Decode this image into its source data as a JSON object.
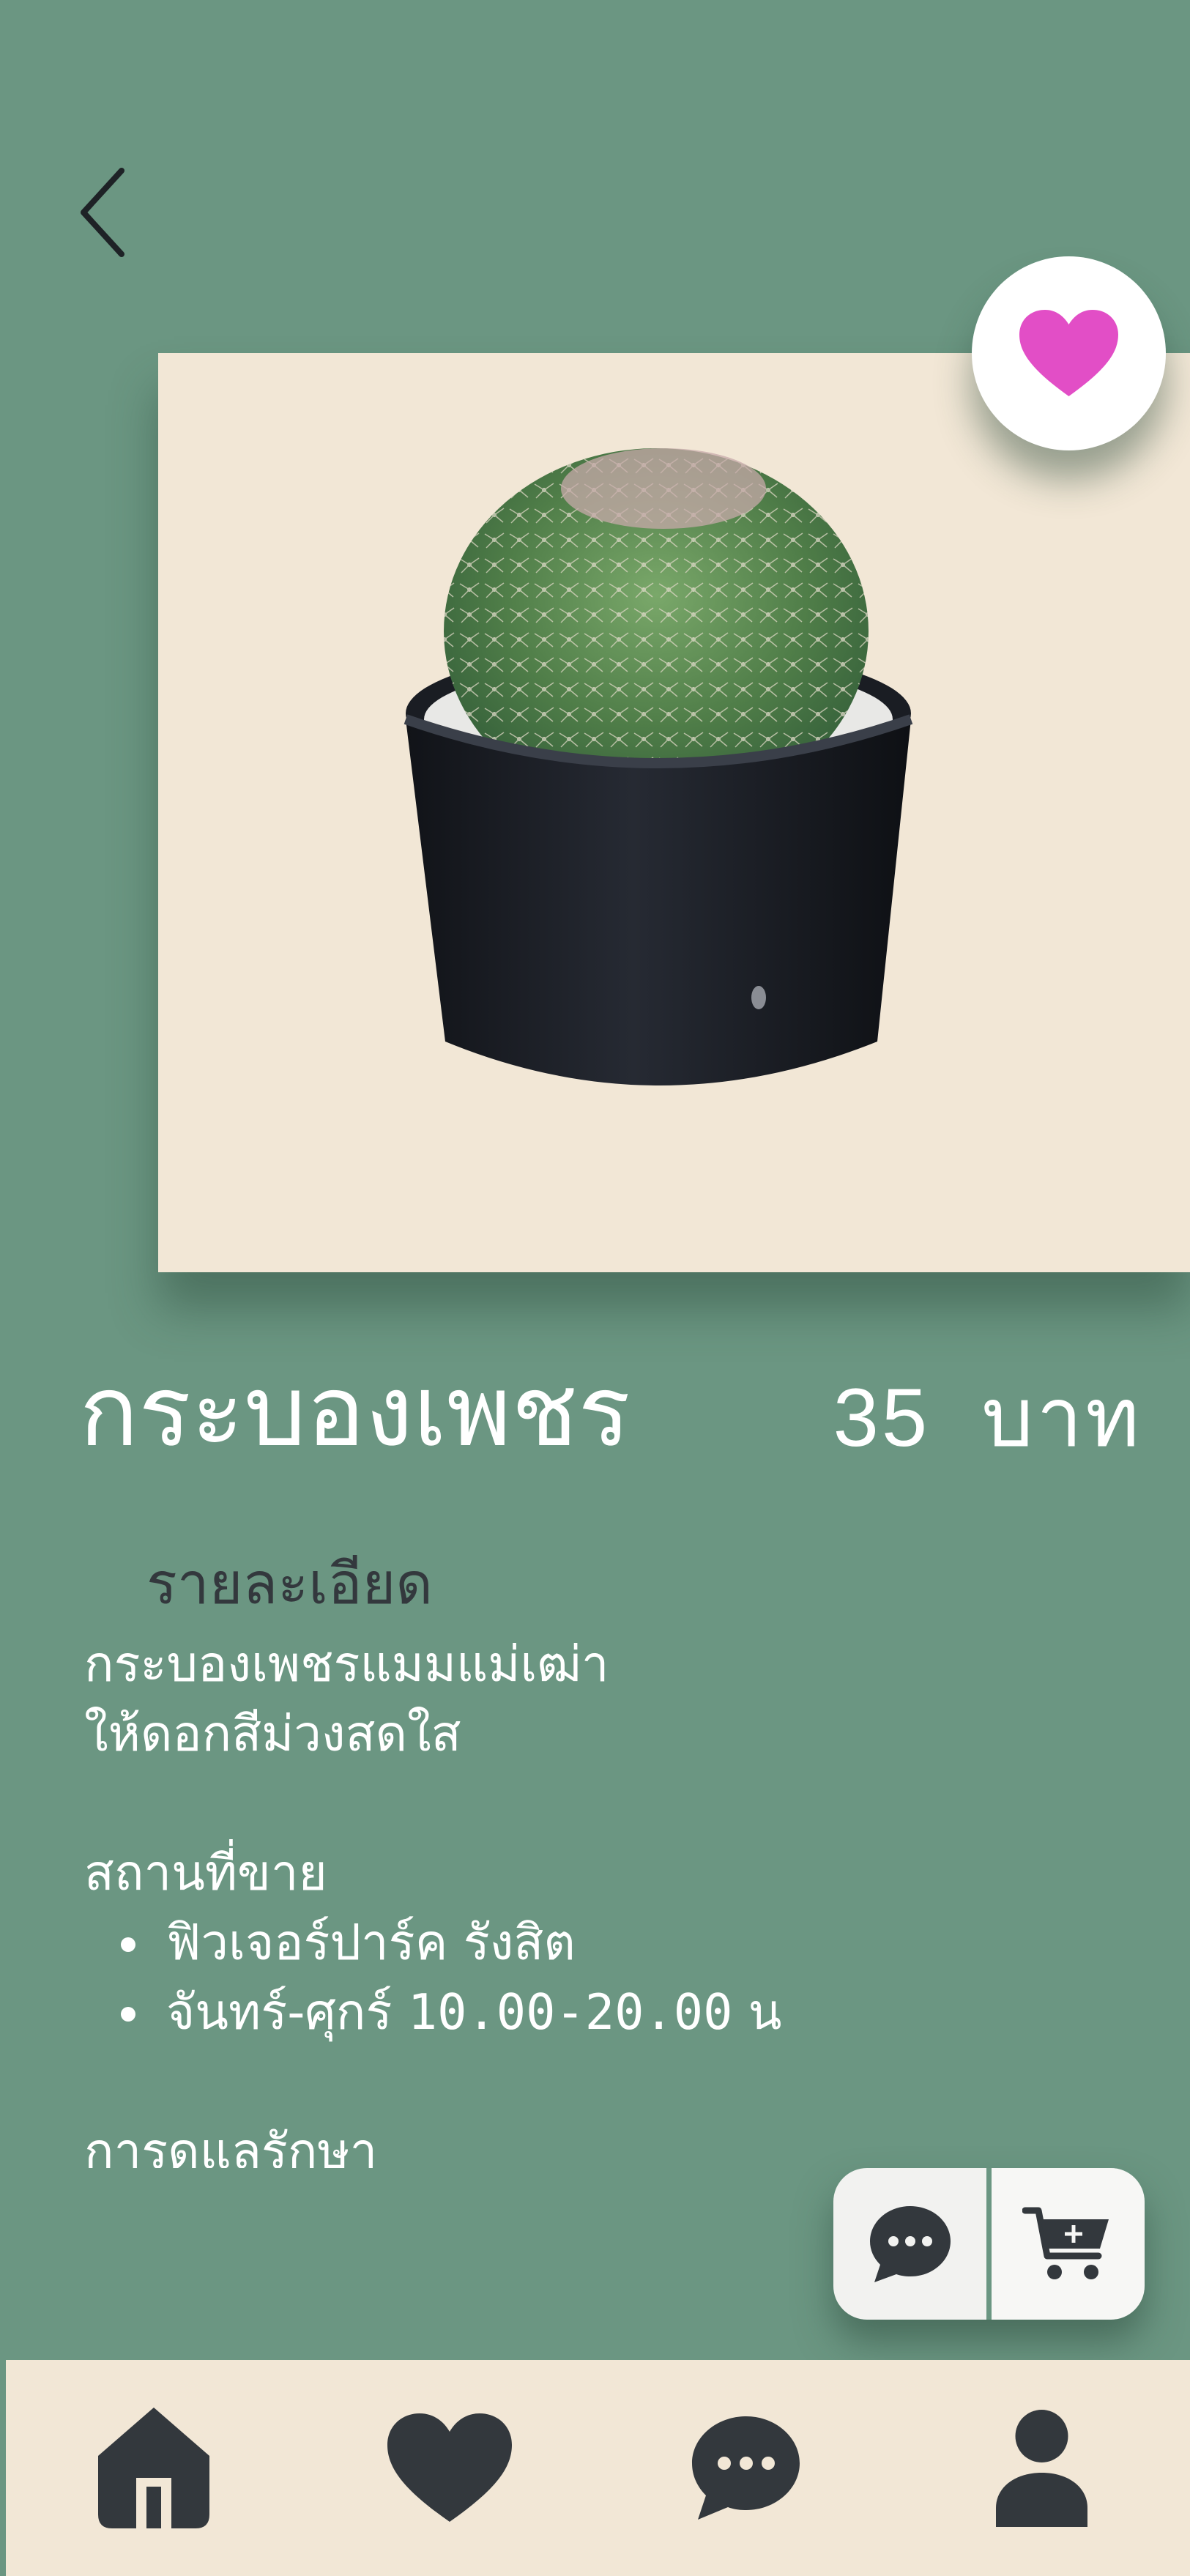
{
  "colors": {
    "background": "#6b9682",
    "card": "#f2e7d6",
    "heart": "#e24ec6",
    "icon_dark": "#33383d",
    "text_light": "#ffffff"
  },
  "header": {
    "back_icon": "chevron-left-icon",
    "favorite_icon": "heart-icon"
  },
  "product": {
    "name": "กระบองเพชร",
    "price_value": "35",
    "price_unit": "บาท",
    "image_icon": "cactus-in-pot-photo"
  },
  "details": {
    "section_label": "รายละเอียด",
    "description_lines": [
      "กระบองเพชรแมมแม่เฒ่า",
      "ให้ดอกสีม่วงสดใส"
    ],
    "sale_heading": "สถานที่ขาย",
    "sale_locations": [
      {
        "thai": "ฟิวเจอร์ปาร์ค รังสิต",
        "mono": ""
      },
      {
        "thai": "จันทร์-ศุกร์ ",
        "mono": "10.00-20.00",
        "suffix": " น"
      }
    ],
    "care_heading": "การดูแลรักษา"
  },
  "actions": {
    "chat_icon": "chat-bubble-icon",
    "add_to_cart_icon": "cart-plus-icon"
  },
  "bottom_nav": [
    {
      "id": "home",
      "icon": "home-icon"
    },
    {
      "id": "favorites",
      "icon": "heart-icon"
    },
    {
      "id": "chat",
      "icon": "chat-bubble-icon"
    },
    {
      "id": "profile",
      "icon": "user-icon"
    }
  ]
}
